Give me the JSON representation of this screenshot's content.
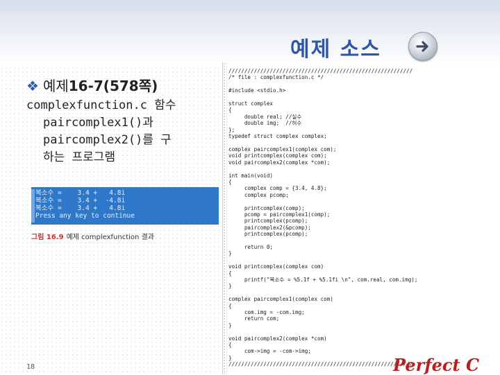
{
  "slide": {
    "title": "예제 소스",
    "bullet_symbol": "❖",
    "bullet_prefix": "예제",
    "bullet_bold": "16-7(578쪽)",
    "description_lines": [
      "complexfunction.c 함수",
      "paircomplex1()과",
      "paircomplex2()를 구",
      "하는 프로그램"
    ],
    "page_number": "18",
    "footer": "Perfect C"
  },
  "console": {
    "lines": [
      "복소수 =    3.4 +   4.8i",
      "복소수 =    3.4 +  -4.8i",
      "복소수 =    3.4 +   4.8i",
      "Press any key to continue"
    ]
  },
  "caption": {
    "figure_label": "그림 16.9",
    "text": "예제 complexfunction 결과"
  },
  "code": {
    "lines": [
      "//////////////////////////////////////////////////////////",
      "/* file : complexfunction.c */",
      "",
      "#include <stdio.h>",
      "",
      "struct complex",
      "{",
      "     double real; //실수",
      "     double img;  //허수",
      "};",
      "typedef struct complex complex;",
      "",
      "complex paircomplex1(complex com);",
      "void printcomplex(complex com);",
      "void paircomplex2(complex *com);",
      "",
      "int main(void)",
      "{",
      "     complex comp = {3.4, 4.8};",
      "     complex pcomp;",
      "",
      "     printcomplex(comp);",
      "     pcomp = paircomplex1(comp);",
      "     printcomplex(pcomp);",
      "     paircomplex2(&pcomp);",
      "     printcomplex(pcomp);",
      "",
      "     return 0;",
      "}",
      "",
      "void printcomplex(complex com)",
      "{",
      "     printf(\"복소수 = %5.1f + %5.1fi \\n\", com.real, com.img);",
      "}",
      "",
      "complex paircomplex1(complex com)",
      "{",
      "     com.img = -com.img;",
      "     return com;",
      "}",
      "",
      "void paircomplex2(complex *com)",
      "{",
      "     com->img = -com->img;",
      "}",
      "//////////////////////////////////////////////////////////"
    ]
  },
  "colors": {
    "title": "#2f56a6",
    "console_bg": "#2f78c9",
    "footer": "#b81f1f",
    "caption_label": "#c9302c"
  },
  "icons": {
    "nav": "arrow-right-circle-icon",
    "bullet": "diamond-bullet-icon"
  }
}
